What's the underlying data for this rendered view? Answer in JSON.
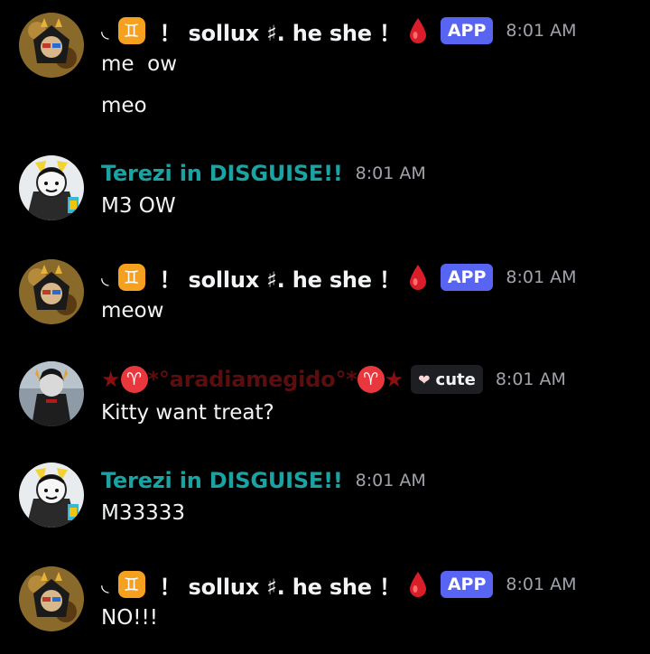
{
  "messages": [
    {
      "author": {
        "prefix": "◟",
        "zodiac": "♊",
        "name": "！ sollux ♯. he she ！",
        "badge": "APP"
      },
      "time": "8:01 AM",
      "lines": [
        "me  ow",
        "meo"
      ]
    },
    {
      "author": {
        "name": "Terezi in DISGUISE!!"
      },
      "time": "8:01 AM",
      "lines": [
        "M3 OW"
      ]
    },
    {
      "author": {
        "prefix": "◟",
        "zodiac": "♊",
        "name": "！ sollux ♯. he she ！",
        "badge": "APP"
      },
      "time": "8:01 AM",
      "lines": [
        "meow"
      ]
    },
    {
      "author": {
        "star": "★",
        "zodiac": "♈",
        "name": "*°aradiamegido°*",
        "badge": "cute",
        "badge_icon": "heart-icon"
      },
      "time": "8:01 AM",
      "lines": [
        "Kitty want treat?"
      ]
    },
    {
      "author": {
        "name": "Terezi in DISGUISE!!"
      },
      "time": "8:01 AM",
      "lines": [
        "M33333"
      ]
    },
    {
      "author": {
        "prefix": "◟",
        "zodiac": "♊",
        "name": "！ sollux ♯. he she ！",
        "badge": "APP"
      },
      "time": "8:01 AM",
      "lines": [
        "NO!!!"
      ]
    }
  ],
  "colors": {
    "background": "#000000",
    "sollux_name": "#f2f3f5",
    "terezi_name": "#1aa3a3",
    "aradia_name": "#5c0d0d",
    "app_badge": "#5865f2",
    "timestamp": "#a0a3ab"
  },
  "icons": [
    "sollux-avatar",
    "terezi-avatar",
    "aradia-avatar",
    "gemini-icon",
    "blood-drop-icon",
    "aries-icon",
    "heart-icon"
  ]
}
